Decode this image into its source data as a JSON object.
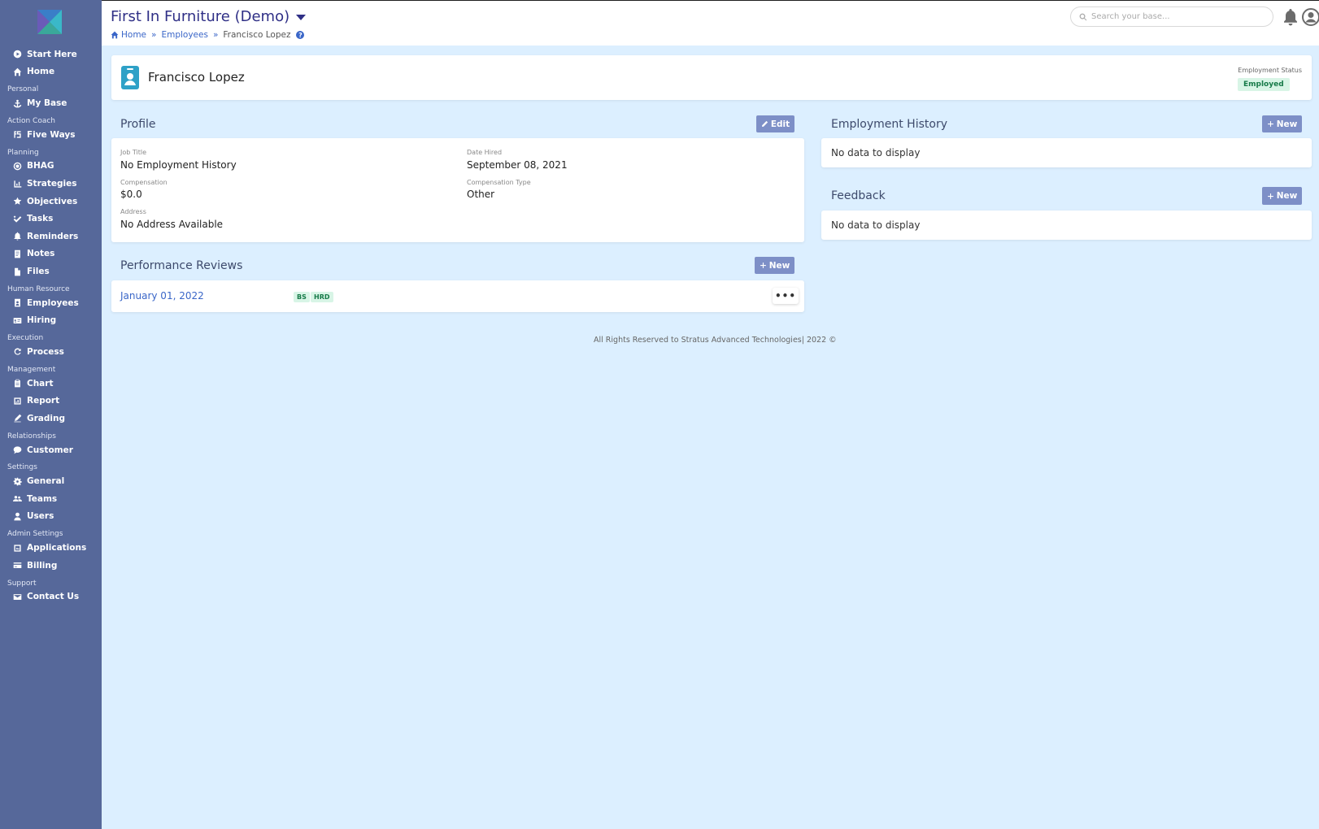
{
  "sidebar": {
    "logo": "stratus-logo",
    "items": [
      {
        "type": "item",
        "label": "Start Here",
        "icon": "play-circle-icon"
      },
      {
        "type": "item",
        "label": "Home",
        "icon": "home-icon"
      },
      {
        "type": "section",
        "label": "Personal"
      },
      {
        "type": "item",
        "label": "My Base",
        "icon": "anchor-icon"
      },
      {
        "type": "section",
        "label": "Action Coach"
      },
      {
        "type": "item",
        "label": "Five Ways",
        "icon": "five-ways-icon"
      },
      {
        "type": "section",
        "label": "Planning"
      },
      {
        "type": "item",
        "label": "BHAG",
        "icon": "target-icon"
      },
      {
        "type": "item",
        "label": "Strategies",
        "icon": "strategy-icon"
      },
      {
        "type": "item",
        "label": "Objectives",
        "icon": "star-icon"
      },
      {
        "type": "item",
        "label": "Tasks",
        "icon": "check-double-icon"
      },
      {
        "type": "item",
        "label": "Reminders",
        "icon": "bell-icon"
      },
      {
        "type": "item",
        "label": "Notes",
        "icon": "note-icon"
      },
      {
        "type": "item",
        "label": "Files",
        "icon": "file-icon"
      },
      {
        "type": "section",
        "label": "Human Resource"
      },
      {
        "type": "item",
        "label": "Employees",
        "icon": "id-badge-icon"
      },
      {
        "type": "item",
        "label": "Hiring",
        "icon": "id-card-icon"
      },
      {
        "type": "section",
        "label": "Execution"
      },
      {
        "type": "item",
        "label": "Process",
        "icon": "redo-icon"
      },
      {
        "type": "section",
        "label": "Management"
      },
      {
        "type": "item",
        "label": "Chart",
        "icon": "clipboard-icon"
      },
      {
        "type": "item",
        "label": "Report",
        "icon": "report-icon"
      },
      {
        "type": "item",
        "label": "Grading",
        "icon": "pen-icon"
      },
      {
        "type": "section",
        "label": "Relationships"
      },
      {
        "type": "item",
        "label": "Customer",
        "icon": "comment-icon"
      },
      {
        "type": "section",
        "label": "Settings"
      },
      {
        "type": "item",
        "label": "General",
        "icon": "gear-icon"
      },
      {
        "type": "item",
        "label": "Teams",
        "icon": "users-icon"
      },
      {
        "type": "item",
        "label": "Users",
        "icon": "user-icon"
      },
      {
        "type": "section",
        "label": "Admin Settings"
      },
      {
        "type": "item",
        "label": "Applications",
        "icon": "app-icon"
      },
      {
        "type": "item",
        "label": "Billing",
        "icon": "credit-card-icon"
      },
      {
        "type": "section",
        "label": "Support"
      },
      {
        "type": "item",
        "label": "Contact Us",
        "icon": "envelope-icon"
      }
    ]
  },
  "header": {
    "org_title": "First In Furniture (Demo)",
    "breadcrumb": {
      "home": "Home",
      "separator": "»",
      "employees": "Employees",
      "current": "Francisco Lopez",
      "help": "?"
    },
    "search_placeholder": "Search your base..."
  },
  "employee": {
    "name": "Francisco Lopez",
    "status_label": "Employment Status",
    "status": "Employed"
  },
  "profile": {
    "title": "Profile",
    "edit_label": "Edit",
    "job_title_label": "Job Title",
    "job_title": "No Employment History",
    "date_hired_label": "Date Hired",
    "date_hired": "September 08, 2021",
    "compensation_label": "Compensation",
    "compensation": "$0.0",
    "compensation_type_label": "Compensation Type",
    "compensation_type": "Other",
    "address_label": "Address",
    "address": "No Address Available"
  },
  "employment_history": {
    "title": "Employment History",
    "new_label": "New",
    "empty": "No data to display"
  },
  "feedback": {
    "title": "Feedback",
    "new_label": "New",
    "empty": "No data to display"
  },
  "performance_reviews": {
    "title": "Performance Reviews",
    "new_label": "New",
    "items": [
      {
        "date": "January 01, 2022",
        "tags": [
          "BS",
          "HRD"
        ],
        "menu": "•••"
      }
    ]
  },
  "footer": {
    "text": "All Rights Reserved to Stratus Advanced Technologies| 2022 ©"
  },
  "colors": {
    "sidebar_bg": "#56689a",
    "page_bg": "#dcefff",
    "title": "#2f2f86",
    "link": "#3a66c8",
    "button": "#7d8fc7",
    "badge_bg": "#d8f5e6",
    "badge_text": "#167a48"
  }
}
